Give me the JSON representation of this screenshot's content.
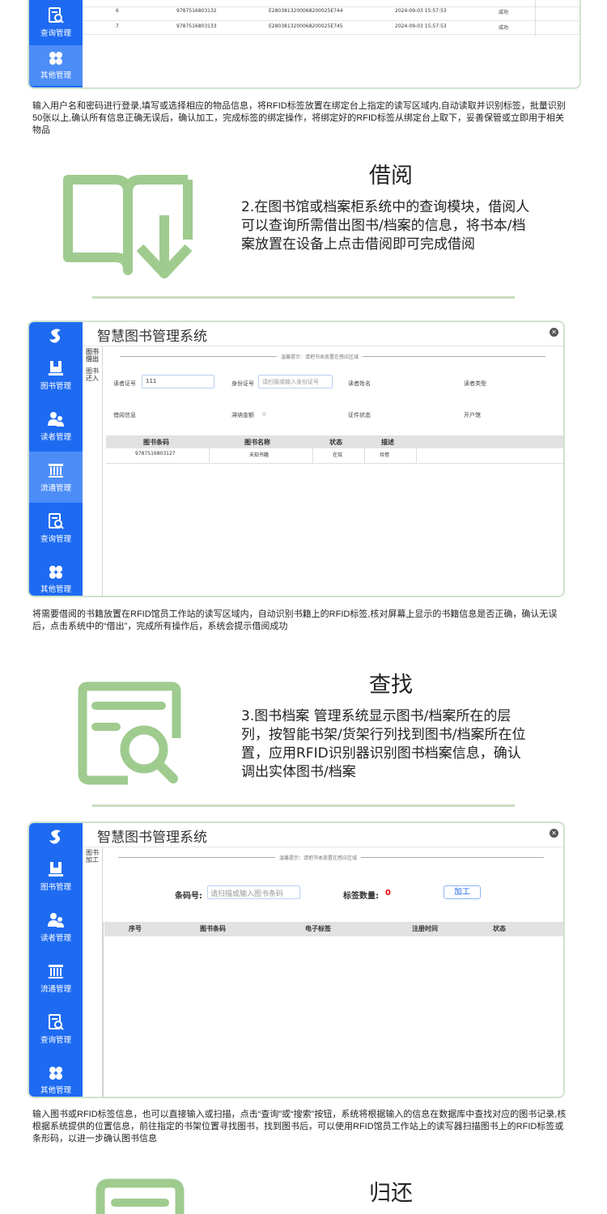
{
  "colors": {
    "sidebar": "#1e6bf2",
    "sidebar_active": "#4d8df7",
    "icon_green": "#9fcb8f",
    "accent_red": "#e00000"
  },
  "top_window": {
    "rows": [
      {
        "no": "6",
        "barcode": "9787516803132",
        "rfid": "E2803813200068200025E744",
        "time": "2024-09-03 15:57:53",
        "status": "成功"
      },
      {
        "no": "7",
        "barcode": "9787516803133",
        "rfid": "E2803813200068200025E745",
        "time": "2024-09-03 15:57:53",
        "status": "成功"
      }
    ],
    "sidebar": [
      {
        "label": "查询管理",
        "icon": "search-doc-icon"
      },
      {
        "label": "其他管理",
        "icon": "grid-icon"
      }
    ]
  },
  "caption1": "输入用户名和密码进行登录,填写或选择相应的物品信息，将RFID标签放置在绑定台上指定的读写区域内,自动读取并识别标签，批量识别50张以上,确认所有信息正确无误后，确认加工，完成标签的绑定操作，将绑定好的RFID标签从绑定台上取下，妥善保管或立即用于相关物品",
  "feature_borrow": {
    "title": "借阅",
    "body": "2.在图书馆或档案柜系统中的查询模块，借阅人可以查询所需借出图书/档案的信息，将书本/档案放置在设备上点击借阅即可完成借阅",
    "icon": "book-download-icon"
  },
  "window_borrow": {
    "title": "智慧图书管理系统",
    "sidebar": [
      {
        "label": "图书管理",
        "icon": "book-icon"
      },
      {
        "label": "读者管理",
        "icon": "users-icon"
      },
      {
        "label": "流通管理",
        "icon": "bookshelf-icon"
      },
      {
        "label": "查询管理",
        "icon": "search-doc-icon"
      },
      {
        "label": "其他管理",
        "icon": "grid-icon"
      }
    ],
    "tabs": [
      "图书借出",
      "图书还入"
    ],
    "hint": "温馨提示：请把书本放置在感应区域",
    "fields": {
      "card_label": "读者证号",
      "card_value": "111",
      "id_label": "身份证号",
      "id_placeholder": "请扫描或输入身份证号",
      "name_label": "读者姓名",
      "type_label": "读者类型",
      "borrow_label": "借阅信息",
      "deposit_label": "滞纳金额",
      "deposit_value": "0",
      "cert_label": "证件状态",
      "branch_label": "开户馆"
    },
    "table": {
      "headers": [
        "图书条码",
        "图书名称",
        "状态",
        "描述"
      ],
      "rows": [
        {
          "barcode": "9787516803127",
          "name": "未知书籍",
          "status": "在馆",
          "desc": "待借"
        }
      ]
    }
  },
  "caption2": "将需要借阅的书籍放置在RFID馆员工作站的读写区域内，自动识别书籍上的RFID标签,核对屏幕上显示的书籍信息是否正确，确认无误后，点击系统中的“借出”，完成所有操作后，系统会提示借阅成功",
  "feature_search": {
    "title": "查找",
    "body": "3.图书档案 管理系统显示图书/档案所在的层列，按智能书架/货架行列找到图书/档案所在位置，应用RFID识别器识别图书档案信息，确认调出实体图书/档案",
    "icon": "document-search-icon"
  },
  "window_process": {
    "title": "智慧图书管理系统",
    "tab": "图书加工",
    "hint": "温馨提示：请把书本放置在感应区域",
    "barcode_label": "条码号:",
    "barcode_placeholder": "请扫描或输入图书条码",
    "count_label": "标签数量:",
    "count_value": "0",
    "process_button": "加工",
    "table_headers": [
      "序号",
      "图书条码",
      "电子标签",
      "注册时间",
      "状态"
    ]
  },
  "caption3": "输入图书或RFID标签信息，也可以直接输入或扫描，点击“查询”或“搜索”按钮，系统将根据输入的信息在数据库中查找对应的图书记录,核根据系统提供的位置信息，前往指定的书架位置寻找图书，找到图书后，可以使用RFID馆员工作站上的读写器扫描图书上的RFID标签或条形码，以进一步确认图书信息",
  "feature_return": {
    "title": "归还",
    "icon": "return-icon"
  }
}
